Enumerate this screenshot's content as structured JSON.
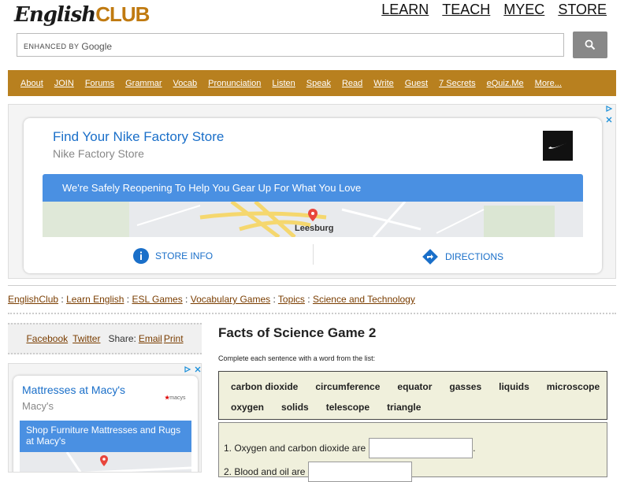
{
  "logo": {
    "part1": "English",
    "part2": "CLUB"
  },
  "topnav": [
    {
      "label": "LEARN"
    },
    {
      "label": "TEACH"
    },
    {
      "label": "MYEC"
    },
    {
      "label": "STORE"
    }
  ],
  "search": {
    "enhanced_by": "ENHANCED BY",
    "google": "Google"
  },
  "mainnav": [
    {
      "label": "About"
    },
    {
      "label": "JOIN"
    },
    {
      "label": "Forums"
    },
    {
      "label": "Grammar"
    },
    {
      "label": "Vocab"
    },
    {
      "label": "Pronunciation"
    },
    {
      "label": "Listen"
    },
    {
      "label": "Speak"
    },
    {
      "label": "Read"
    },
    {
      "label": "Write"
    },
    {
      "label": "Guest"
    },
    {
      "label": "7 Secrets"
    },
    {
      "label": "eQuiz.Me"
    },
    {
      "label": "More..."
    }
  ],
  "ad1": {
    "title": "Find Your Nike Factory Store",
    "subtitle": "Nike Factory Store",
    "banner": "We're Safely Reopening To Help You Gear Up For What You Love",
    "place": "Leesburg",
    "store_info": "STORE INFO",
    "directions": "DIRECTIONS"
  },
  "breadcrumb": [
    {
      "label": "EnglishClub"
    },
    {
      "label": "Learn English"
    },
    {
      "label": "ESL Games"
    },
    {
      "label": "Vocabulary Games"
    },
    {
      "label": "Topics"
    },
    {
      "label": "Science and Technology"
    }
  ],
  "share": {
    "facebook": "Facebook",
    "twitter": "Twitter",
    "label": "Share:",
    "email": "Email",
    "print": "Print"
  },
  "ad2": {
    "title": "Mattresses at Macy's",
    "subtitle": "Macy's",
    "logo": "macys",
    "banner": "Shop Furniture Mattresses and Rugs at Macy's"
  },
  "main": {
    "title": "Facts of Science Game 2",
    "instruction": "Complete each sentence with a word from the list:",
    "words": [
      "carbon dioxide",
      "circumference",
      "equator",
      "gasses",
      "liquids",
      "microscope",
      "oxygen",
      "solids",
      "telescope",
      "triangle"
    ],
    "questions": [
      {
        "text": "1. Oxygen and carbon dioxide are",
        "after": ".",
        "value": ""
      },
      {
        "text": "2. Blood and oil are",
        "after": "",
        "value": ""
      }
    ]
  },
  "colors": {
    "nav_bg": "#b8801f",
    "link": "#7a3d00",
    "ad_blue": "#4a90e2",
    "quiz_bg": "#f0f0dc"
  }
}
